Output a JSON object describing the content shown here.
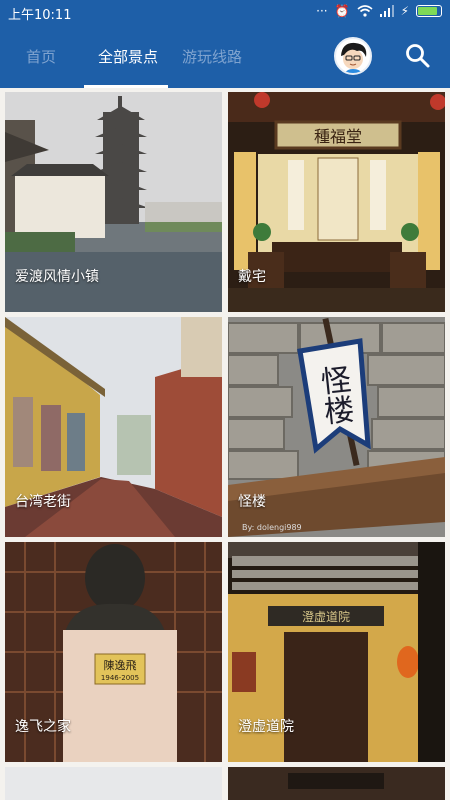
{
  "status": {
    "time": "上午10:11",
    "signal": "···",
    "battery_percent": 85
  },
  "header": {
    "tabs": [
      {
        "label": "首页"
      },
      {
        "label": "全部景点"
      },
      {
        "label": "游玩线路"
      }
    ],
    "active_tab": 1
  },
  "spots": [
    {
      "name": "爱渡风情小镇"
    },
    {
      "name": "戴宅"
    },
    {
      "name": "台湾老街"
    },
    {
      "name": "怪楼"
    },
    {
      "name": "逸飞之家"
    },
    {
      "name": "澄虚道院"
    }
  ],
  "signs": {
    "daizhai_plaque": "種福堂",
    "guailou_banner": "怪楼",
    "yifei_plaque": "陳逸飛",
    "yifei_years": "1946-2005",
    "chengxu_plaque": "澄虚道院",
    "watermark": "By: dolengi989"
  },
  "colors": {
    "primary": "#1e5fa8",
    "tab_inactive": "#7fa3cf",
    "background": "#f4f2ee"
  }
}
